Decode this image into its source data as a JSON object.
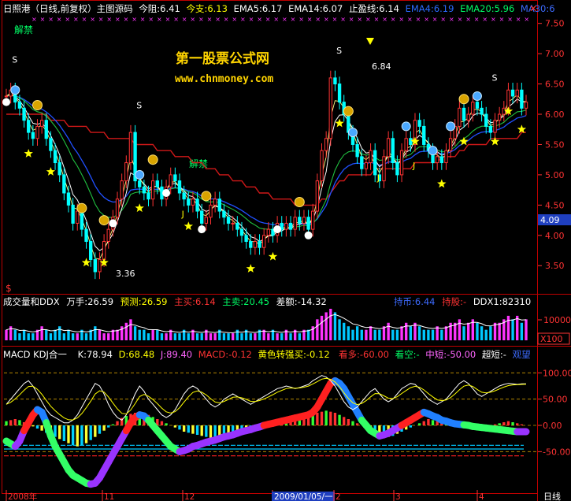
{
  "main_panel": {
    "header": [
      {
        "text": "日照港（日线,前复权）主图源码",
        "color": "#ffffff"
      },
      {
        "text": "今阻:6.41",
        "color": "#ffffff"
      },
      {
        "text": "今支:6.13",
        "color": "#ffff00"
      },
      {
        "text": "EMA5:6.17",
        "color": "#ffffff"
      },
      {
        "text": "EMA14:6.07",
        "color": "#ffffff"
      },
      {
        "text": "止盈线:6.14",
        "color": "#ffffff"
      },
      {
        "text": "EMA4:6.19",
        "color": "#2b6bff"
      },
      {
        "text": "EMA20:5.96",
        "color": "#00ff66"
      },
      {
        "text": "MA30:6",
        "color": "#3d6bff"
      }
    ],
    "unlock_label": "解禁",
    "unlock_label2": "解禁",
    "watermark_title": "第一股票公式网",
    "watermark_url": "www.chnmoney.com",
    "price_annotations": {
      "high": "6.84",
      "low": "3.36"
    },
    "marker_s": "S",
    "marker_j": "J",
    "price_tag": "4.09",
    "bottom_mark": "$"
  },
  "volume_panel": {
    "header": [
      {
        "text": "成交量和DDX",
        "color": "#ffffff"
      },
      {
        "text": "万手:26.59",
        "color": "#ffffff"
      },
      {
        "text": "预测:26.59",
        "color": "#ffff00"
      },
      {
        "text": "主买:6.14",
        "color": "#ff3333"
      },
      {
        "text": "主卖:20.45",
        "color": "#00ff66"
      },
      {
        "text": "差额:-14.32",
        "color": "#ffffff"
      },
      {
        "text": "持币:6.44",
        "color": "#3d6bff"
      },
      {
        "text": "持股:-",
        "color": "#ff3333"
      },
      {
        "text": "DDX1:82310",
        "color": "#ffffff"
      }
    ],
    "axis": {
      "tick": "10000",
      "scale": "X100"
    }
  },
  "macd_panel": {
    "header": [
      {
        "text": "MACD KDJ合一",
        "color": "#ffffff"
      },
      {
        "text": "K:78.94",
        "color": "#ffffff"
      },
      {
        "text": "D:68.48",
        "color": "#ffff00"
      },
      {
        "text": "J:89.40",
        "color": "#ff66ff"
      },
      {
        "text": "MACD:-0.12",
        "color": "#ff3333"
      },
      {
        "text": "黄色转强买:-0.12",
        "color": "#ffff00"
      },
      {
        "text": "看多:-60.00",
        "color": "#ff3333"
      },
      {
        "text": "看空:-",
        "color": "#00ff66"
      },
      {
        "text": "中短:-50.00",
        "color": "#ff66ff"
      },
      {
        "text": "超短:-",
        "color": "#ffffff"
      },
      {
        "text": "观望",
        "color": "#3d6bff"
      }
    ]
  },
  "x_axis": {
    "labels": [
      "2008年",
      "11",
      "12",
      "2009/01/05/一",
      "2",
      "3",
      "4"
    ],
    "period": "日线"
  },
  "colors": {
    "up": "#ff3333",
    "down": "#00ffff",
    "frame": "#c00000",
    "axis_text": "#ff3333",
    "grid": "#c00000"
  },
  "chart_data": [
    {
      "type": "candlestick",
      "ylim": [
        3.1,
        7.6
      ],
      "yticks": [
        "7.50",
        "7.00",
        "6.50",
        "6.00",
        "5.50",
        "5.00",
        "4.50",
        "4.00",
        "3.50"
      ],
      "ytick_values": [
        7.5,
        7.0,
        6.5,
        6.0,
        5.5,
        5.0,
        4.5,
        4.0,
        3.5
      ],
      "close": [
        6.3,
        6.4,
        6.2,
        6.1,
        5.9,
        5.7,
        5.6,
        5.8,
        5.9,
        5.6,
        5.4,
        5.2,
        5.0,
        4.7,
        4.5,
        4.2,
        4.4,
        4.1,
        3.9,
        3.6,
        3.4,
        3.6,
        3.9,
        4.1,
        4.3,
        4.6,
        4.9,
        5.2,
        5.7,
        4.9,
        4.8,
        4.7,
        4.6,
        4.9,
        4.8,
        4.6,
        4.8,
        5.0,
        4.9,
        4.7,
        4.6,
        4.5,
        4.6,
        4.4,
        4.2,
        4.3,
        4.5,
        4.6,
        4.4,
        4.3,
        4.2,
        4.2,
        4.1,
        4.0,
        3.9,
        3.8,
        3.9,
        3.8,
        4.0,
        4.1,
        4.0,
        4.2,
        4.1,
        4.2,
        4.1,
        4.3,
        4.2,
        4.3,
        4.1,
        4.4,
        4.9,
        5.4,
        5.6,
        6.6,
        6.5,
        6.2,
        6.0,
        5.7,
        5.5,
        5.3,
        5.1,
        5.2,
        5.4,
        5.0,
        4.9,
        5.3,
        5.6,
        5.2,
        5.0,
        5.4,
        5.6,
        5.5,
        5.9,
        5.8,
        5.5,
        5.4,
        5.2,
        5.3,
        5.2,
        5.4,
        5.6,
        5.8,
        6.1,
        5.9,
        6.0,
        6.2,
        6.1,
        6.0,
        5.8,
        5.7,
        5.9,
        6.0,
        6.1,
        6.4,
        6.3,
        6.4,
        6.1,
        6.2
      ],
      "ma_long": [
        6.0,
        6.0,
        6.0,
        6.0,
        6.0,
        6.0,
        6.0,
        6.0,
        6.0,
        6.0,
        5.9,
        5.9,
        5.9,
        5.9,
        5.8,
        5.8,
        5.8,
        5.8,
        5.8,
        5.7,
        5.7,
        5.7,
        5.7,
        5.6,
        5.6,
        5.6,
        5.6,
        5.6,
        5.6,
        5.5,
        5.5,
        5.5,
        5.5,
        5.5,
        5.4,
        5.4,
        5.4,
        5.4,
        5.3,
        5.3,
        5.3,
        5.3,
        5.2,
        5.2,
        5.2,
        5.1,
        5.1,
        5.1,
        5.0,
        5.0,
        5.0,
        4.9,
        4.9,
        4.9,
        4.8,
        4.8,
        4.8,
        4.7,
        4.7,
        4.7,
        4.6,
        4.6,
        4.6,
        4.6,
        4.6,
        4.5,
        4.5,
        4.5,
        4.5,
        4.5,
        4.5,
        4.6,
        4.6,
        4.7,
        4.8,
        4.9,
        4.9,
        5.0,
        5.0,
        5.0,
        5.0,
        5.0,
        5.0,
        5.1,
        5.1,
        5.1,
        5.1,
        5.1,
        5.1,
        5.1,
        5.1,
        5.1,
        5.2,
        5.2,
        5.2,
        5.2,
        5.2,
        5.2,
        5.3,
        5.3,
        5.3,
        5.3,
        5.4,
        5.4,
        5.5,
        5.5,
        5.5,
        5.5,
        5.5,
        5.6,
        5.6,
        5.6,
        5.6,
        5.6,
        5.6,
        5.6,
        5.7,
        5.7
      ]
    },
    {
      "type": "bar",
      "ticks": [
        "10000"
      ],
      "volume": [
        3,
        4,
        3,
        2,
        3,
        2,
        2,
        3,
        4,
        3,
        2,
        3,
        4,
        2,
        3,
        2,
        2,
        3,
        2,
        3,
        4,
        3,
        2,
        2,
        3,
        3,
        4,
        5,
        6,
        4,
        3,
        3,
        2,
        3,
        3,
        2,
        2,
        3,
        2,
        2,
        3,
        2,
        3,
        2,
        2,
        3,
        2,
        2,
        3,
        2,
        2,
        2,
        3,
        2,
        3,
        2,
        2,
        3,
        3,
        2,
        3,
        2,
        2,
        3,
        2,
        3,
        2,
        3,
        3,
        4,
        6,
        7,
        8,
        9,
        8,
        6,
        5,
        4,
        3,
        4,
        3,
        3,
        4,
        3,
        3,
        4,
        5,
        3,
        3,
        4,
        5,
        4,
        5,
        4,
        3,
        3,
        3,
        4,
        3,
        4,
        5,
        5,
        6,
        4,
        5,
        6,
        5,
        4,
        3,
        4,
        5,
        5,
        6,
        7,
        6,
        7,
        5,
        6
      ]
    },
    {
      "type": "line",
      "ylim": [
        -120,
        120
      ],
      "yticks": [
        "100.00",
        "50.00",
        "0.00",
        "-50.00"
      ],
      "ytick_values": [
        100,
        50,
        0,
        -50
      ],
      "macd": [
        -30,
        -35,
        -40,
        -30,
        -10,
        5,
        20,
        30,
        25,
        5,
        -20,
        -40,
        -55,
        -70,
        -85,
        -95,
        -100,
        -105,
        -110,
        -112,
        -110,
        -100,
        -85,
        -70,
        -55,
        -40,
        -25,
        -10,
        5,
        15,
        20,
        18,
        10,
        0,
        -10,
        -20,
        -30,
        -40,
        -45,
        -50,
        -48,
        -45,
        -40,
        -38,
        -35,
        -32,
        -30,
        -28,
        -25,
        -22,
        -20,
        -18,
        -15,
        -12,
        -10,
        -8,
        -5,
        -3,
        0,
        2,
        4,
        6,
        8,
        10,
        12,
        14,
        16,
        18,
        20,
        25,
        35,
        50,
        65,
        80,
        85,
        80,
        70,
        55,
        40,
        25,
        10,
        0,
        -10,
        -15,
        -20,
        -18,
        -15,
        -10,
        -5,
        0,
        5,
        10,
        15,
        20,
        25,
        22,
        18,
        15,
        10,
        8,
        5,
        3,
        2,
        1,
        0,
        -2,
        -3,
        -4,
        -5,
        -6,
        -7,
        -8,
        -9,
        -10,
        -11,
        -12,
        -12,
        -12
      ],
      "k": [
        40,
        50,
        60,
        70,
        80,
        85,
        75,
        60,
        45,
        30,
        20,
        15,
        10,
        5,
        5,
        10,
        20,
        35,
        50,
        65,
        80,
        75,
        60,
        40,
        25,
        15,
        10,
        20,
        40,
        60,
        75,
        65,
        50,
        40,
        30,
        20,
        15,
        20,
        30,
        45,
        60,
        70,
        75,
        70,
        60,
        50,
        40,
        35,
        40,
        50,
        55,
        60,
        55,
        50,
        45,
        40,
        45,
        50,
        55,
        60,
        65,
        70,
        72,
        75,
        73,
        70,
        72,
        75,
        78,
        85,
        90,
        95,
        92,
        85,
        75,
        60,
        45,
        35,
        30,
        35,
        45,
        55,
        65,
        70,
        60,
        50,
        45,
        50,
        60,
        70,
        75,
        80,
        78,
        70,
        60,
        50,
        45,
        40,
        45,
        50,
        60,
        70,
        80,
        85,
        80,
        70,
        60,
        55,
        60,
        65,
        70,
        75,
        78,
        80,
        79,
        78,
        79,
        79
      ],
      "hist": [
        8,
        10,
        12,
        10,
        6,
        2,
        -2,
        -6,
        -10,
        -14,
        -18,
        -22,
        -26,
        -30,
        -34,
        -38,
        -40,
        -38,
        -34,
        -28,
        -22,
        -16,
        -10,
        -4,
        2,
        8,
        14,
        18,
        22,
        24,
        26,
        24,
        20,
        16,
        12,
        8,
        4,
        0,
        -4,
        -8,
        -12,
        -14,
        -16,
        -18,
        -20,
        -22,
        -24,
        -22,
        -20,
        -18,
        -16,
        -14,
        -12,
        -10,
        -8,
        -6,
        -4,
        -2,
        0,
        2,
        4,
        6,
        8,
        10,
        12,
        14,
        16,
        18,
        20,
        22,
        24,
        26,
        28,
        26,
        24,
        20,
        16,
        12,
        8,
        4,
        0,
        -4,
        -8,
        -12,
        -16,
        -20,
        -22,
        -20,
        -16,
        -12,
        -8,
        -4,
        0,
        4,
        8,
        12,
        10,
        8,
        6,
        4,
        2,
        0,
        -2,
        -4,
        -6,
        -8,
        -6,
        -4,
        -2,
        0,
        2,
        4,
        6,
        8,
        6,
        4,
        2,
        0
      ],
      "level_lines": [
        -38,
        -45,
        -58
      ]
    }
  ]
}
